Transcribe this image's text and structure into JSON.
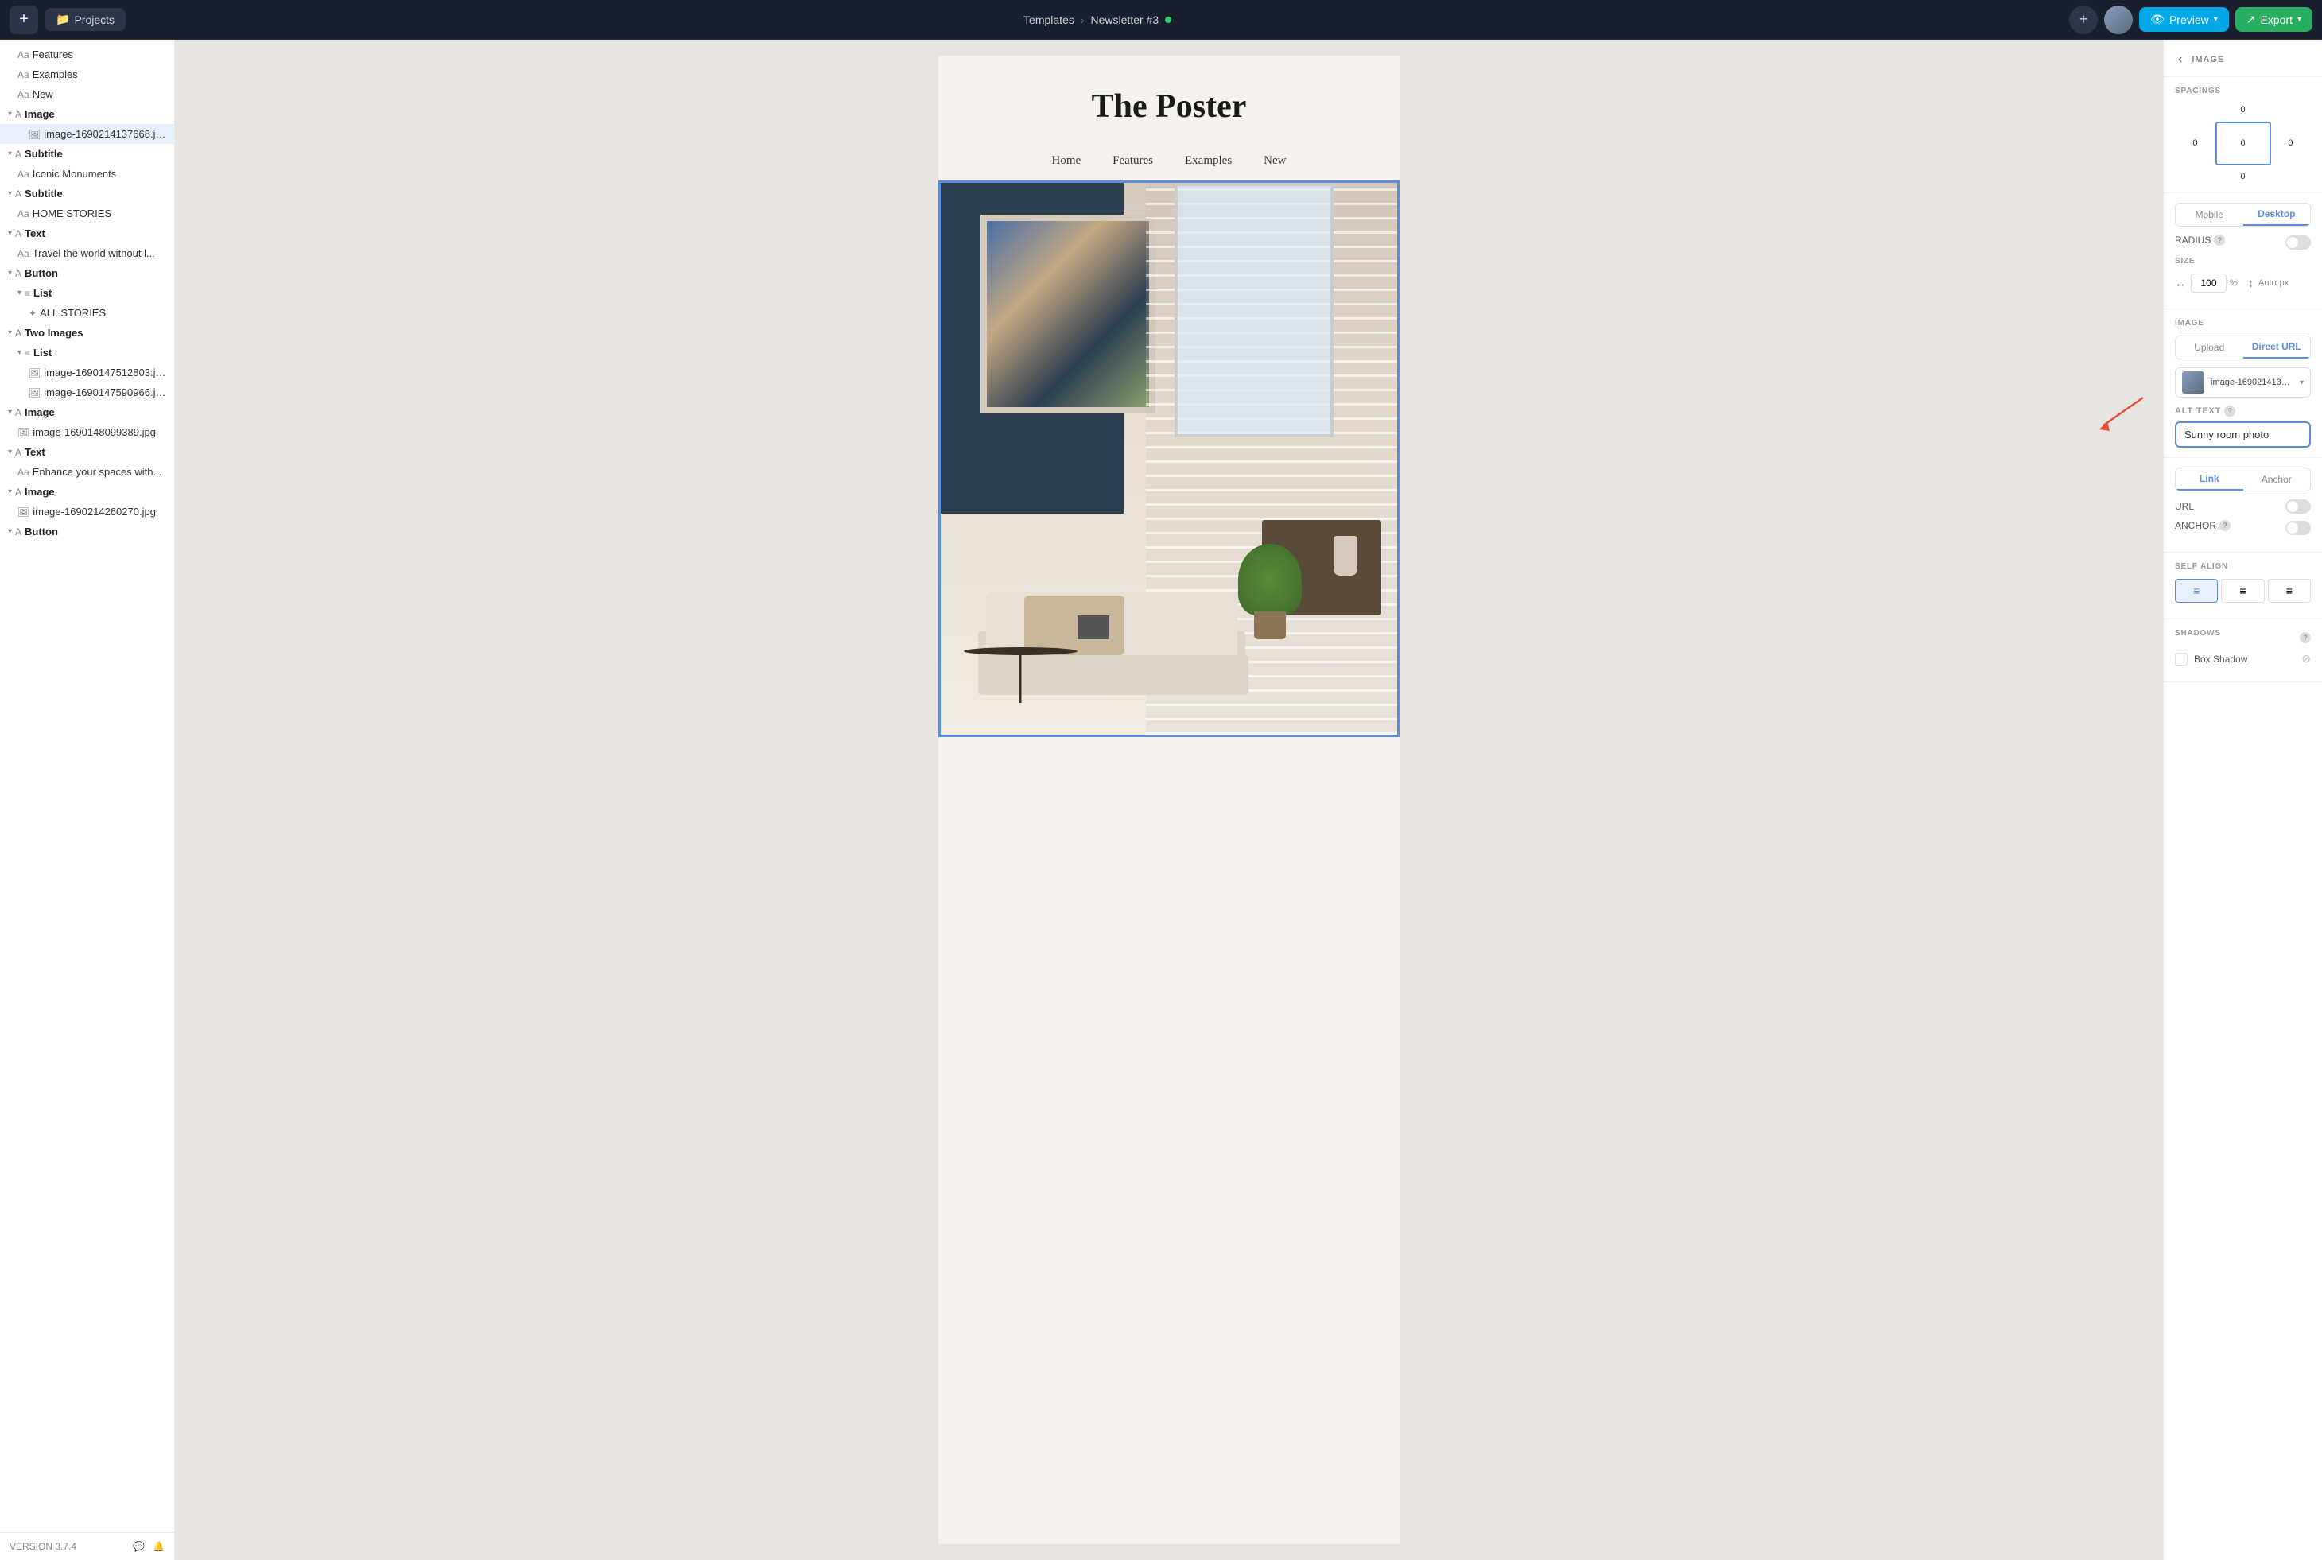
{
  "topnav": {
    "plus_label": "+",
    "projects_label": "Projects",
    "breadcrumb_part1": "Templates",
    "breadcrumb_sep": "›",
    "breadcrumb_part2": "Newsletter #3",
    "preview_label": "Preview",
    "export_label": "Export"
  },
  "sidebar": {
    "items": [
      {
        "id": "features-text",
        "label": "Features",
        "icon": "Aa",
        "indent": 1,
        "type": "text"
      },
      {
        "id": "examples-text",
        "label": "Examples",
        "icon": "Aa",
        "indent": 1,
        "type": "text"
      },
      {
        "id": "new-text",
        "label": "New",
        "icon": "Aa",
        "indent": 1,
        "type": "text"
      },
      {
        "id": "image-block",
        "label": "Image",
        "icon": "A",
        "indent": 0,
        "type": "block",
        "arrow": "▾"
      },
      {
        "id": "image-file-1",
        "label": "image-1690214137668.jpg",
        "icon": "🖼",
        "indent": 2,
        "type": "file",
        "selected": true
      },
      {
        "id": "subtitle-1",
        "label": "Subtitle",
        "icon": "A",
        "indent": 0,
        "type": "block",
        "arrow": "▾"
      },
      {
        "id": "iconic-text",
        "label": "Iconic Monuments",
        "icon": "Aa",
        "indent": 1,
        "type": "text"
      },
      {
        "id": "subtitle-2",
        "label": "Subtitle",
        "icon": "A",
        "indent": 0,
        "type": "block",
        "arrow": "▾"
      },
      {
        "id": "home-stories-text",
        "label": "HOME STORIES",
        "icon": "Aa",
        "indent": 1,
        "type": "text"
      },
      {
        "id": "text-block-1",
        "label": "Text",
        "icon": "A",
        "indent": 0,
        "type": "block",
        "arrow": "▾"
      },
      {
        "id": "travel-text",
        "label": "Travel the world without l...",
        "icon": "Aa",
        "indent": 1,
        "type": "text"
      },
      {
        "id": "button-block-1",
        "label": "Button",
        "icon": "A",
        "indent": 0,
        "type": "block",
        "arrow": "▾"
      },
      {
        "id": "list-block-1",
        "label": "List",
        "icon": "≡",
        "indent": 1,
        "type": "list",
        "arrow": "▾"
      },
      {
        "id": "all-stories-text",
        "label": "ALL STORIES",
        "icon": "✦",
        "indent": 2,
        "type": "text"
      },
      {
        "id": "two-images-block",
        "label": "Two Images",
        "icon": "A",
        "indent": 0,
        "type": "block",
        "arrow": "▾"
      },
      {
        "id": "list-block-2",
        "label": "List",
        "icon": "≡",
        "indent": 1,
        "type": "list",
        "arrow": "▾"
      },
      {
        "id": "image-file-2",
        "label": "image-1690147512803.jpg",
        "icon": "🖼",
        "indent": 2,
        "type": "file"
      },
      {
        "id": "image-file-3",
        "label": "image-1690147590966.jpg",
        "icon": "🖼",
        "indent": 2,
        "type": "file"
      },
      {
        "id": "image-block-2",
        "label": "Image",
        "icon": "A",
        "indent": 0,
        "type": "block",
        "arrow": "▾"
      },
      {
        "id": "image-file-4",
        "label": "image-1690148099389.jpg",
        "icon": "🖼",
        "indent": 1,
        "type": "file"
      },
      {
        "id": "text-block-2",
        "label": "Text",
        "icon": "A",
        "indent": 0,
        "type": "block",
        "arrow": "▾"
      },
      {
        "id": "enhance-text",
        "label": "Enhance your spaces with...",
        "icon": "Aa",
        "indent": 1,
        "type": "text"
      },
      {
        "id": "image-block-3",
        "label": "Image",
        "icon": "A",
        "indent": 0,
        "type": "block",
        "arrow": "▾"
      },
      {
        "id": "image-file-5",
        "label": "image-1690214260270.jpg",
        "icon": "🖼",
        "indent": 1,
        "type": "file"
      },
      {
        "id": "button-block-2",
        "label": "Button",
        "icon": "A",
        "indent": 0,
        "type": "block",
        "arrow": "▾"
      }
    ],
    "version": "VERSION 3.7.4"
  },
  "canvas": {
    "email_title": "The Poster",
    "nav_items": [
      "Home",
      "Features",
      "Examples",
      "New"
    ]
  },
  "right_panel": {
    "title": "IMAGE",
    "spacings_label": "SPACINGS",
    "spacing_top": "0",
    "spacing_bottom": "0",
    "spacing_left": "0",
    "spacing_right": "0",
    "spacing_inner": "0",
    "mobile_label": "Mobile",
    "desktop_label": "Desktop",
    "radius_label": "RADIUS",
    "size_label": "SIZE",
    "size_width_value": "100",
    "size_width_unit": "%",
    "size_height_label": "Auto",
    "size_height_unit": "px",
    "image_section_label": "IMAGE",
    "upload_label": "Upload",
    "direct_url_label": "Direct URL",
    "image_filename": "image-1690214137668....",
    "alt_text_label": "ALT TEXT",
    "alt_text_value": "Sunny room photo",
    "alt_text_placeholder": "Sunny room photo",
    "link_label": "Link",
    "anchor_label": "Anchor",
    "url_label": "URL",
    "anchor_field_label": "ANCHOR",
    "self_align_label": "SELF ALIGN",
    "shadows_label": "SHADOWS",
    "box_shadow_label": "Box Shadow"
  }
}
